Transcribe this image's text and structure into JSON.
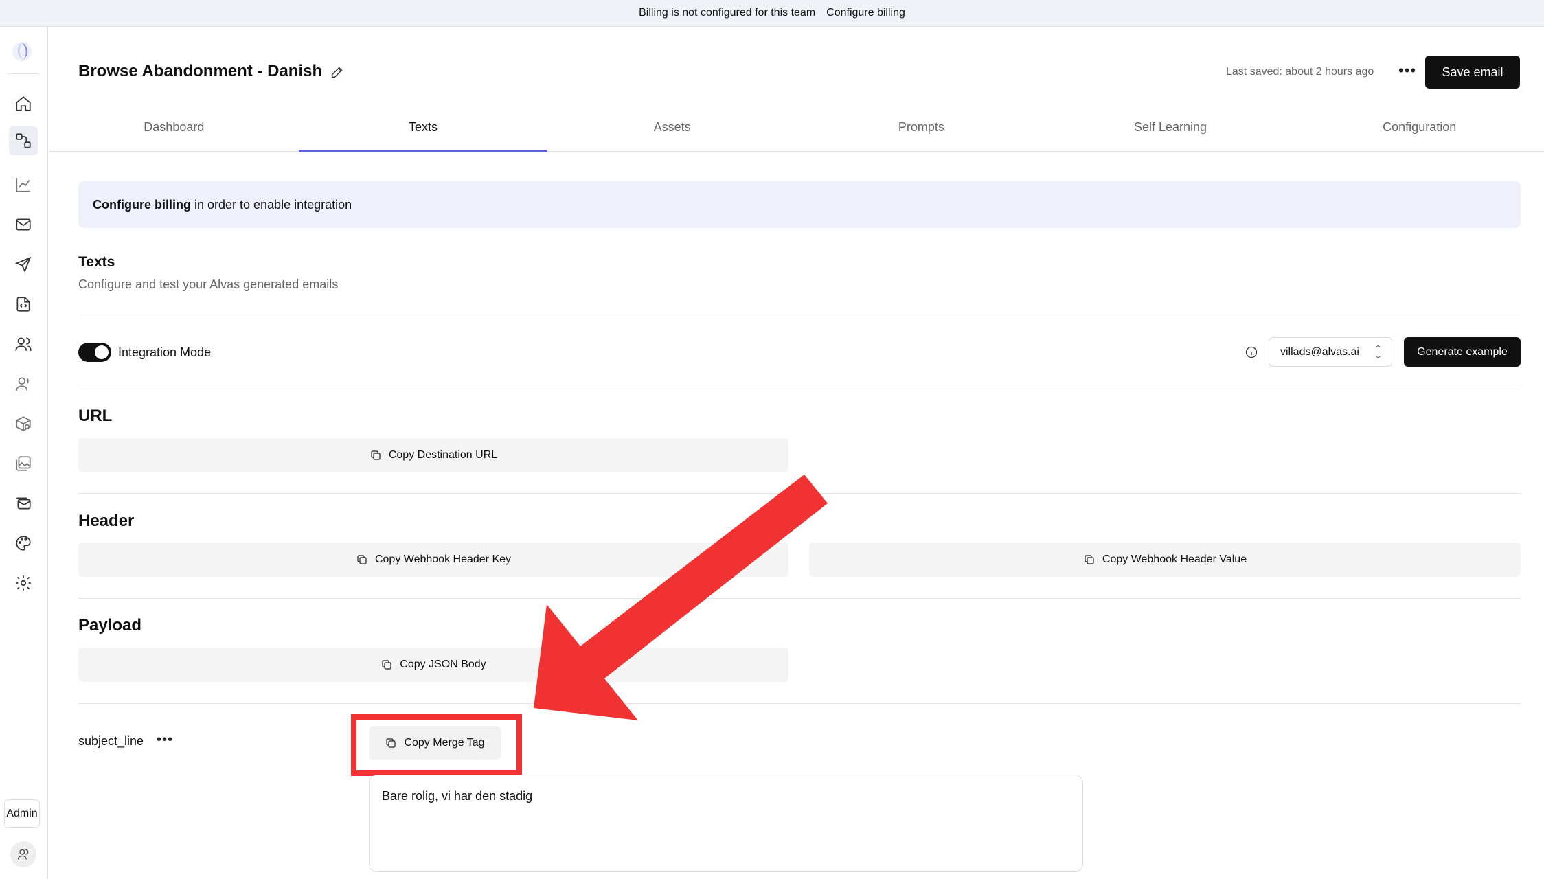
{
  "banner": {
    "message": "Billing is not configured for this team",
    "link": "Configure billing"
  },
  "sidebar": {
    "items": [
      {
        "icon": "home-icon"
      },
      {
        "icon": "flows-icon",
        "active": true
      },
      {
        "icon": "chart-icon"
      },
      {
        "icon": "mail-icon"
      },
      {
        "icon": "send-icon"
      },
      {
        "icon": "code-file-icon"
      },
      {
        "icon": "users-icon"
      },
      {
        "icon": "user-icon"
      },
      {
        "icon": "box-search-icon"
      },
      {
        "icon": "images-icon"
      },
      {
        "icon": "mail-stack-icon"
      },
      {
        "icon": "palette-icon"
      },
      {
        "icon": "gear-icon"
      }
    ],
    "admin_label": "Admin"
  },
  "header": {
    "title": "Browse Abandonment - Danish",
    "last_saved": "Last saved: about 2 hours ago",
    "save_label": "Save email"
  },
  "tabs": [
    {
      "label": "Dashboard"
    },
    {
      "label": "Texts",
      "active": true
    },
    {
      "label": "Assets"
    },
    {
      "label": "Prompts"
    },
    {
      "label": "Self Learning"
    },
    {
      "label": "Configuration"
    }
  ],
  "notice": {
    "bold": "Configure billing",
    "rest": "in order to enable integration"
  },
  "texts_section": {
    "title": "Texts",
    "description": "Configure and test your Alvas generated emails"
  },
  "integration": {
    "toggle_label": "Integration Mode",
    "toggle_on": true,
    "selected_user": "villads@alvas.ai",
    "generate_label": "Generate example"
  },
  "url_section": {
    "title": "URL",
    "copy_url": "Copy Destination URL"
  },
  "header_section": {
    "title": "Header",
    "copy_key": "Copy Webhook Header Key",
    "copy_value": "Copy Webhook Header Value"
  },
  "payload_section": {
    "title": "Payload",
    "copy_json": "Copy JSON Body"
  },
  "field": {
    "name": "subject_line",
    "copy_merge": "Copy Merge Tag",
    "value": "Bare rolig, vi har den stadig"
  },
  "colors": {
    "accent": "#5b63d3",
    "annotation": "#f03232",
    "primary_button": "#111111"
  }
}
